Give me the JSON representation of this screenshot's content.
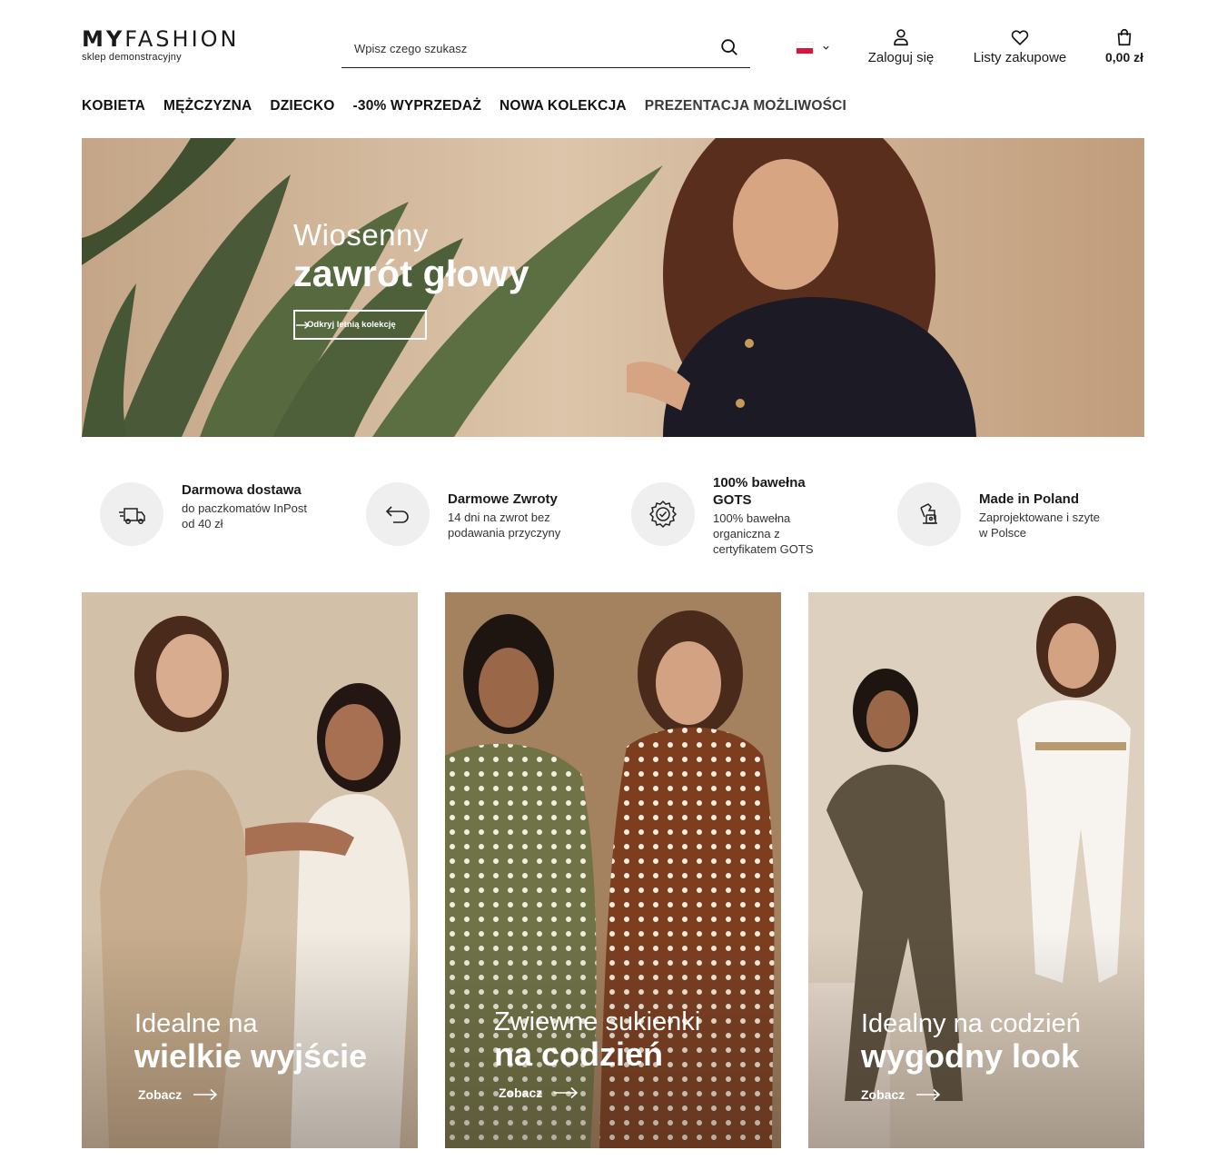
{
  "header": {
    "logo": {
      "bold": "MY",
      "light": "FASHION",
      "subtitle": "sklep  demonstracyjny"
    },
    "search": {
      "placeholder": "Wpisz czego szukasz"
    },
    "login_label": "Zaloguj się",
    "lists_label": "Listy zakupowe",
    "cart_total": "0,00 zł"
  },
  "nav": {
    "items": [
      {
        "label": "KOBIETA"
      },
      {
        "label": "MĘŻCZYZNA"
      },
      {
        "label": "DZIECKO"
      },
      {
        "label": "-30% WYPRZEDAŻ"
      },
      {
        "label": "NOWA KOLEKCJA"
      },
      {
        "label": "PREZENTACJA MOŻLIWOŚCI"
      }
    ]
  },
  "hero": {
    "line1": "Wiosenny",
    "line2": "zawrót głowy",
    "button": "Odkryj letnią kolekcję"
  },
  "features": [
    {
      "icon": "delivery-truck-icon",
      "title": "Darmowa dostawa",
      "desc": "do paczkomatów InPost od 40 zł"
    },
    {
      "icon": "return-arrow-icon",
      "title": "Darmowe Zwroty",
      "desc": "14 dni na zwrot bez podawania przyczyny"
    },
    {
      "icon": "certificate-badge-icon",
      "title": "100% bawełna GOTS",
      "desc": "100% bawełna organiczna z certyfikatem GOTS"
    },
    {
      "icon": "sewing-machine-icon",
      "title": "Made in Poland",
      "desc": "Zaprojektowane i szyte w Polsce"
    }
  ],
  "cards": [
    {
      "line1": "Idealne na",
      "line2": "wielkie wyjście",
      "button": "Zobacz"
    },
    {
      "line1": "Zwiewne sukienki",
      "line2": "na codzień",
      "button": "Zobacz"
    },
    {
      "line1": "Idealny na codzień",
      "line2": "wygodny look",
      "button": "Zobacz"
    }
  ],
  "colors": {
    "text": "#1a1a1a",
    "circle_bg": "#efefef",
    "flag_red": "#dc143c"
  }
}
